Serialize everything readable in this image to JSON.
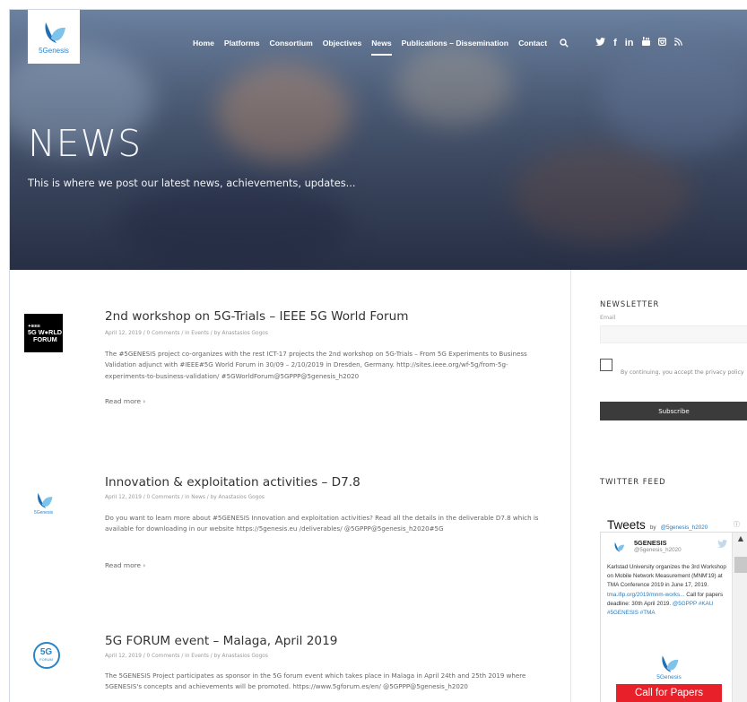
{
  "brand": {
    "logo_text": "5Genesis",
    "accent_color": "#2a84c7"
  },
  "nav": {
    "items": [
      {
        "label": "Home"
      },
      {
        "label": "Platforms"
      },
      {
        "label": "Consortium"
      },
      {
        "label": "Objectives"
      },
      {
        "label": "News",
        "active": true
      },
      {
        "label": "Publications – Dissemination"
      },
      {
        "label": "Contact"
      }
    ],
    "search_icon": "search-icon",
    "social_icons": [
      "twitter-icon",
      "facebook-icon",
      "linkedin-icon",
      "youtube-icon",
      "instagram-icon",
      "rss-icon"
    ]
  },
  "hero": {
    "title": "NEWS",
    "subtitle": "This is where we post our latest news, achievements, updates..."
  },
  "posts": [
    {
      "title": "2nd workshop on 5G-Trials – IEEE 5G World Forum",
      "meta": "April 12, 2019 / 0 Comments / in Events / by Anastasios Gogos",
      "body": "The #5GENESIS project co-organizes with the rest ICT-17 projects the 2nd workshop on 5G-Trials – From 5G Experiments to Business Validation adjunct with #IEEE#5G World Forum in 30/09 – 2/10/2019 in Dresden, Germany. http://sites.ieee.org/wf-5g/from-5g-experiments-to-business-validation/ #5GWorldForum@5GPPP@5genesis_h2020",
      "read_more": "Read more ›",
      "thumb": {
        "line1": "✦IEEE",
        "line2": "5G W●RLD",
        "line3": "FORUM"
      }
    },
    {
      "title": "Innovation & exploitation activities – D7.8",
      "meta": "April 12, 2019 / 0 Comments / in News / by Anastasios Gogos",
      "body": "Do you want to learn more about #5GENESIS Innovation and exploitation activities? Read all the details in the deliverable D7.8 which is available for downloading in our website https://5genesis.eu /deliverables/ @5GPPP@5genesis_h2020#5G",
      "read_more": "Read more ›",
      "thumb": {
        "label": "5Genesis"
      }
    },
    {
      "title": "5G FORUM event – Malaga, April 2019",
      "meta": "April 12, 2019 / 0 Comments / in Events / by Anastasios Gogos",
      "body": "The 5GENESIS Project participates as sponsor in the 5G forum event which takes place in Malaga in April 24th and 25th 2019 where 5GENESIS's concepts and achievements will be promoted. https://www.5gforum.es/en/ @5GPPP@5genesis_h2020",
      "thumb": {
        "big": "5G",
        "small": "FORUM"
      }
    }
  ],
  "newsletter": {
    "heading": "NEWSLETTER",
    "email_label": "Email",
    "consent_text": "By continuing, you accept the privacy policy",
    "subscribe_label": "Subscribe"
  },
  "twitter": {
    "heading": "TWITTER FEED",
    "widget_title": "Tweets",
    "by_label": "by",
    "by_handle": "@5genesis_h2020",
    "tweet": {
      "name": "5GENESIS",
      "handle": "@5genesis_h2020",
      "text": "Karlstad University organizes the 3rd Workshop on Mobile Network Measurement (MNM'19) at TMA Conference 2019 in June 17, 2019.",
      "link": "tma.ifip.org/2019/mnm-works...",
      "text2": "Call for papers deadline: 30th April 2019.",
      "hashtags": "@5GPPP #KAU #5GENESIS #TMA",
      "image_logo_text": "5Genesis",
      "image_banner": "Call for Papers"
    }
  }
}
